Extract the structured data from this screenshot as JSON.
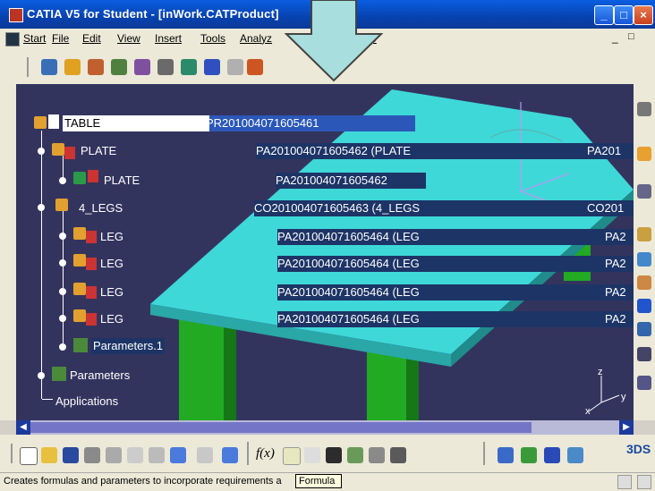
{
  "window": {
    "title": "CATIA V5 for Student - [inWork.CATProduct]",
    "minimize_glyph": "_",
    "maximize_glyph": "□",
    "close_glyph": "×"
  },
  "menu": {
    "items": [
      "Start",
      "File",
      "Edit",
      "View",
      "Insert",
      "Tools",
      "Analyz",
      "p"
    ],
    "doc_controls": [
      "_",
      "□"
    ]
  },
  "tree": {
    "nodes": [
      {
        "name": "TABLE",
        "part_number": "PR201004071605461"
      },
      {
        "name": "PLATE",
        "part_number": "PA201004071605462 (PLATE",
        "tail": "PA201"
      },
      {
        "name": "PLATE",
        "part_number": "PA201004071605462"
      },
      {
        "name": "4_LEGS",
        "part_number": "CO201004071605463 (4_LEGS",
        "tail": "CO201"
      },
      {
        "name": "LEG",
        "part_number": "PA201004071605464 (LEG",
        "tail": "PA2"
      },
      {
        "name": "LEG",
        "part_number": "PA201004071605464 (LEG",
        "tail": "PA2"
      },
      {
        "name": "LEG",
        "part_number": "PA201004071605464 (LEG",
        "tail": "PA2"
      },
      {
        "name": "LEG",
        "part_number": "PA201004071605464 (LEG",
        "tail": "PA2"
      },
      {
        "name": "Parameters.1"
      },
      {
        "name": "Parameters"
      },
      {
        "name": "Applications"
      }
    ]
  },
  "compass": {
    "axis_z": "z",
    "axis_y": "y",
    "axis_x": "x"
  },
  "status": {
    "message": "Creates formulas and parameters to incorporate requirements a",
    "tooltip": "Formula"
  },
  "colors": {
    "viewport_bg": "#33345e",
    "plate": "#3ed8d8",
    "legs": "#22aa22",
    "title_blue": "#0a5fe0",
    "arrow_fill": "#a8dede"
  },
  "icons": {
    "top_toolbar": [
      "sketch-icon",
      "assembly-icon",
      "part-icon",
      "constraint-icon",
      "anchor-icon",
      "paperclip-icon",
      "clash-icon",
      "flex-icon",
      "reorder-icon",
      "multi-instance-icon"
    ],
    "bottom_toolbar": [
      "new-icon",
      "open-icon",
      "save-icon",
      "print-icon",
      "cut-icon",
      "copy-icon",
      "paste-icon",
      "undo-icon",
      "redo-icon",
      "whats-this-icon",
      "formula-icon",
      "comment-icon",
      "knowledge-icon",
      "table-icon",
      "equation-icon",
      "lock-icon",
      "law-icon",
      "fly-icon",
      "fit-all-icon",
      "pan-icon",
      "rotate-icon",
      "catia-logo-icon"
    ]
  }
}
